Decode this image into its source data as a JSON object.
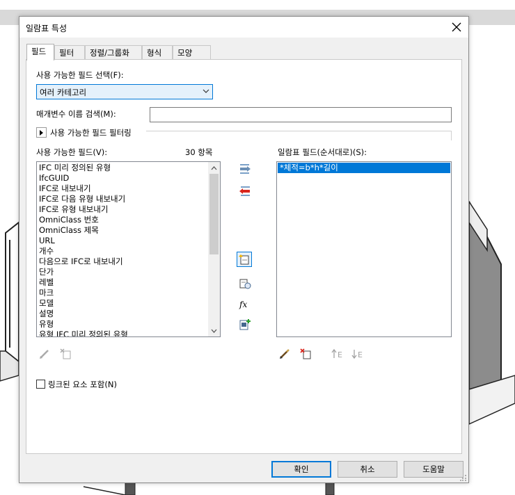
{
  "dialog": {
    "title": "일람표 특성"
  },
  "tabs": [
    {
      "label": "필드"
    },
    {
      "label": "필터"
    },
    {
      "label": "정렬/그룹화"
    },
    {
      "label": "형식"
    },
    {
      "label": "모양"
    }
  ],
  "fields_tab": {
    "select_label": "사용 가능한 필드 선택(F):",
    "category_value": "여러 카테고리",
    "search_label": "매개변수 이름 검색(M):",
    "search_value": "",
    "filter_label": "사용 가능한 필드 필터링",
    "available_label": "사용 가능한 필드(V):",
    "available_count": "30 항목",
    "available_items": [
      "IFC 미리 정의된 유형",
      "IfcGUID",
      "IFC로 내보내기",
      "IFC로 다음 유형 내보내기",
      "IFC로 유형 내보내기",
      "OmniClass 번호",
      "OmniClass 제목",
      "URL",
      "개수",
      "다음으로 IFC로 내보내기",
      "단가",
      "레벨",
      "마크",
      "모델",
      "설명",
      "유형",
      "유형 IFC 미리 정의된 유형"
    ],
    "scheduled_label": "일람표 필드(순서대로)(S):",
    "scheduled_items": [
      "*체적=b*h*길이"
    ],
    "include_linked_label": "링크된 요소 포함(N)"
  },
  "buttons": {
    "ok": "확인",
    "cancel": "취소",
    "help": "도움말"
  },
  "icons": {
    "add": "add-parameter-icon",
    "remove": "remove-parameter-icon",
    "new_param": "new-parameter-icon",
    "edit": "edit-pencil-icon",
    "formula": "formula-fx-icon",
    "combine": "combine-parameters-icon",
    "delete": "delete-parameter-icon",
    "move_up": "move-up-icon",
    "move_down": "move-down-icon"
  },
  "colors": {
    "accent": "#0078d7",
    "selection": "#0078d7",
    "remove_arrow": "#d9261c",
    "add_icon_green": "#2aa12a"
  }
}
